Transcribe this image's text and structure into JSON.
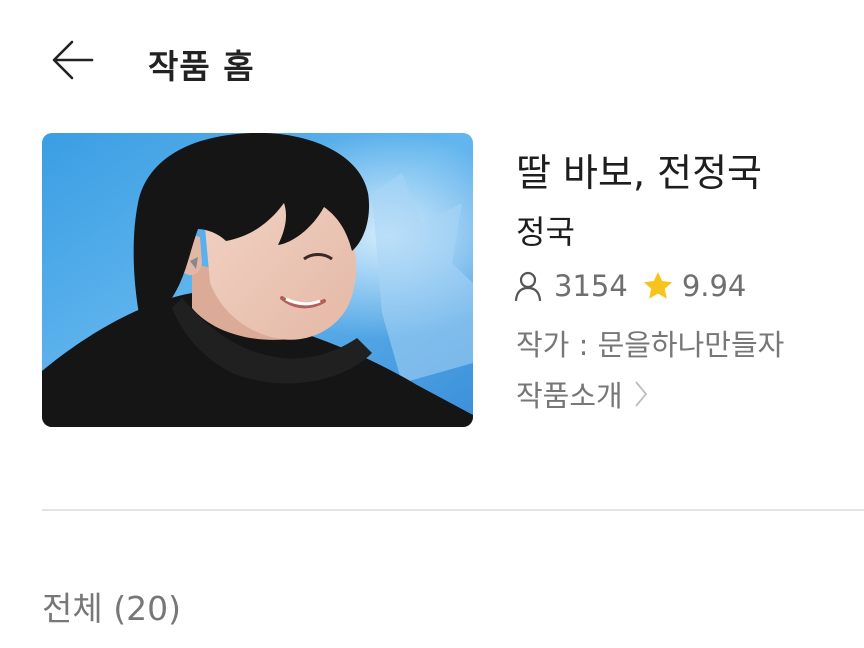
{
  "header": {
    "title": "작품 홈",
    "back_icon": "back-arrow-icon"
  },
  "work": {
    "title": "딸 바보, 전정국",
    "subtitle": "정국",
    "views": "3154",
    "rating": "9.94",
    "author": "작가 : 문을하나만들자",
    "intro_label": "작품소개",
    "cover_image": "cover-photo-young-man-black-hoodie-blue-background"
  },
  "episodes": {
    "count_label": "전체 (20)"
  },
  "colors": {
    "star": "#f8c31c",
    "muted_text": "#777777",
    "divider": "#e3e3e3"
  }
}
